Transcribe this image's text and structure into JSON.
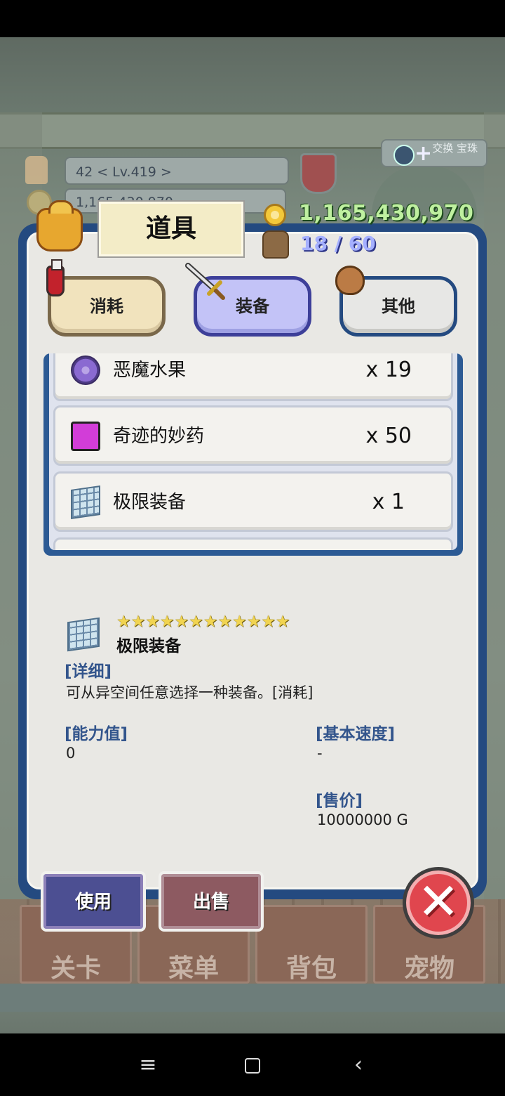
{
  "hud": {
    "level_text": "42    < Lv.419 >",
    "gold_faded": "1,165,430,970",
    "exchange_label": "交换 宝珠"
  },
  "bottom_nav": {
    "tabs": [
      "关卡",
      "菜单",
      "背包",
      "宠物"
    ]
  },
  "modal": {
    "title": "道具",
    "gold": "1,165,430,970",
    "slots": "18 / 60",
    "categories": [
      {
        "label": "消耗",
        "icon": "potion-icon",
        "state": "normal"
      },
      {
        "label": "装备",
        "icon": "sword-icon",
        "state": "selected"
      },
      {
        "label": "其他",
        "icon": "sack-icon",
        "state": "normal"
      }
    ],
    "items": [
      {
        "name": "恶魔水果",
        "qty": "x 19",
        "icon": "purple-fruit-icon"
      },
      {
        "name": "奇迹的妙药",
        "qty": "x 50",
        "icon": "magic-potion-icon"
      },
      {
        "name": "极限装备",
        "qty": "x 1",
        "icon": "crystal-cube-icon"
      }
    ],
    "detail": {
      "stars": "★★★★★★★★★★★★",
      "star_count": 12,
      "name": "极限装备",
      "detail_label": "[详细]",
      "description": "可从异空间任意选择一种装备。[消耗]",
      "power_label": "[能力值]",
      "power_value": "0",
      "speed_label": "[基本速度]",
      "speed_value": "-",
      "price_label": "[售价]",
      "price_value": "10000000 G"
    },
    "actions": {
      "use": "使用",
      "sell": "出售"
    }
  },
  "system_nav": {
    "menu": "≡",
    "back": "‹"
  },
  "colors": {
    "modal_frame": "#244a80",
    "gold_text": "#bff0a0",
    "slot_text": "#a5b0ff",
    "label_blue": "#33558c",
    "close_red": "#e0464e"
  }
}
